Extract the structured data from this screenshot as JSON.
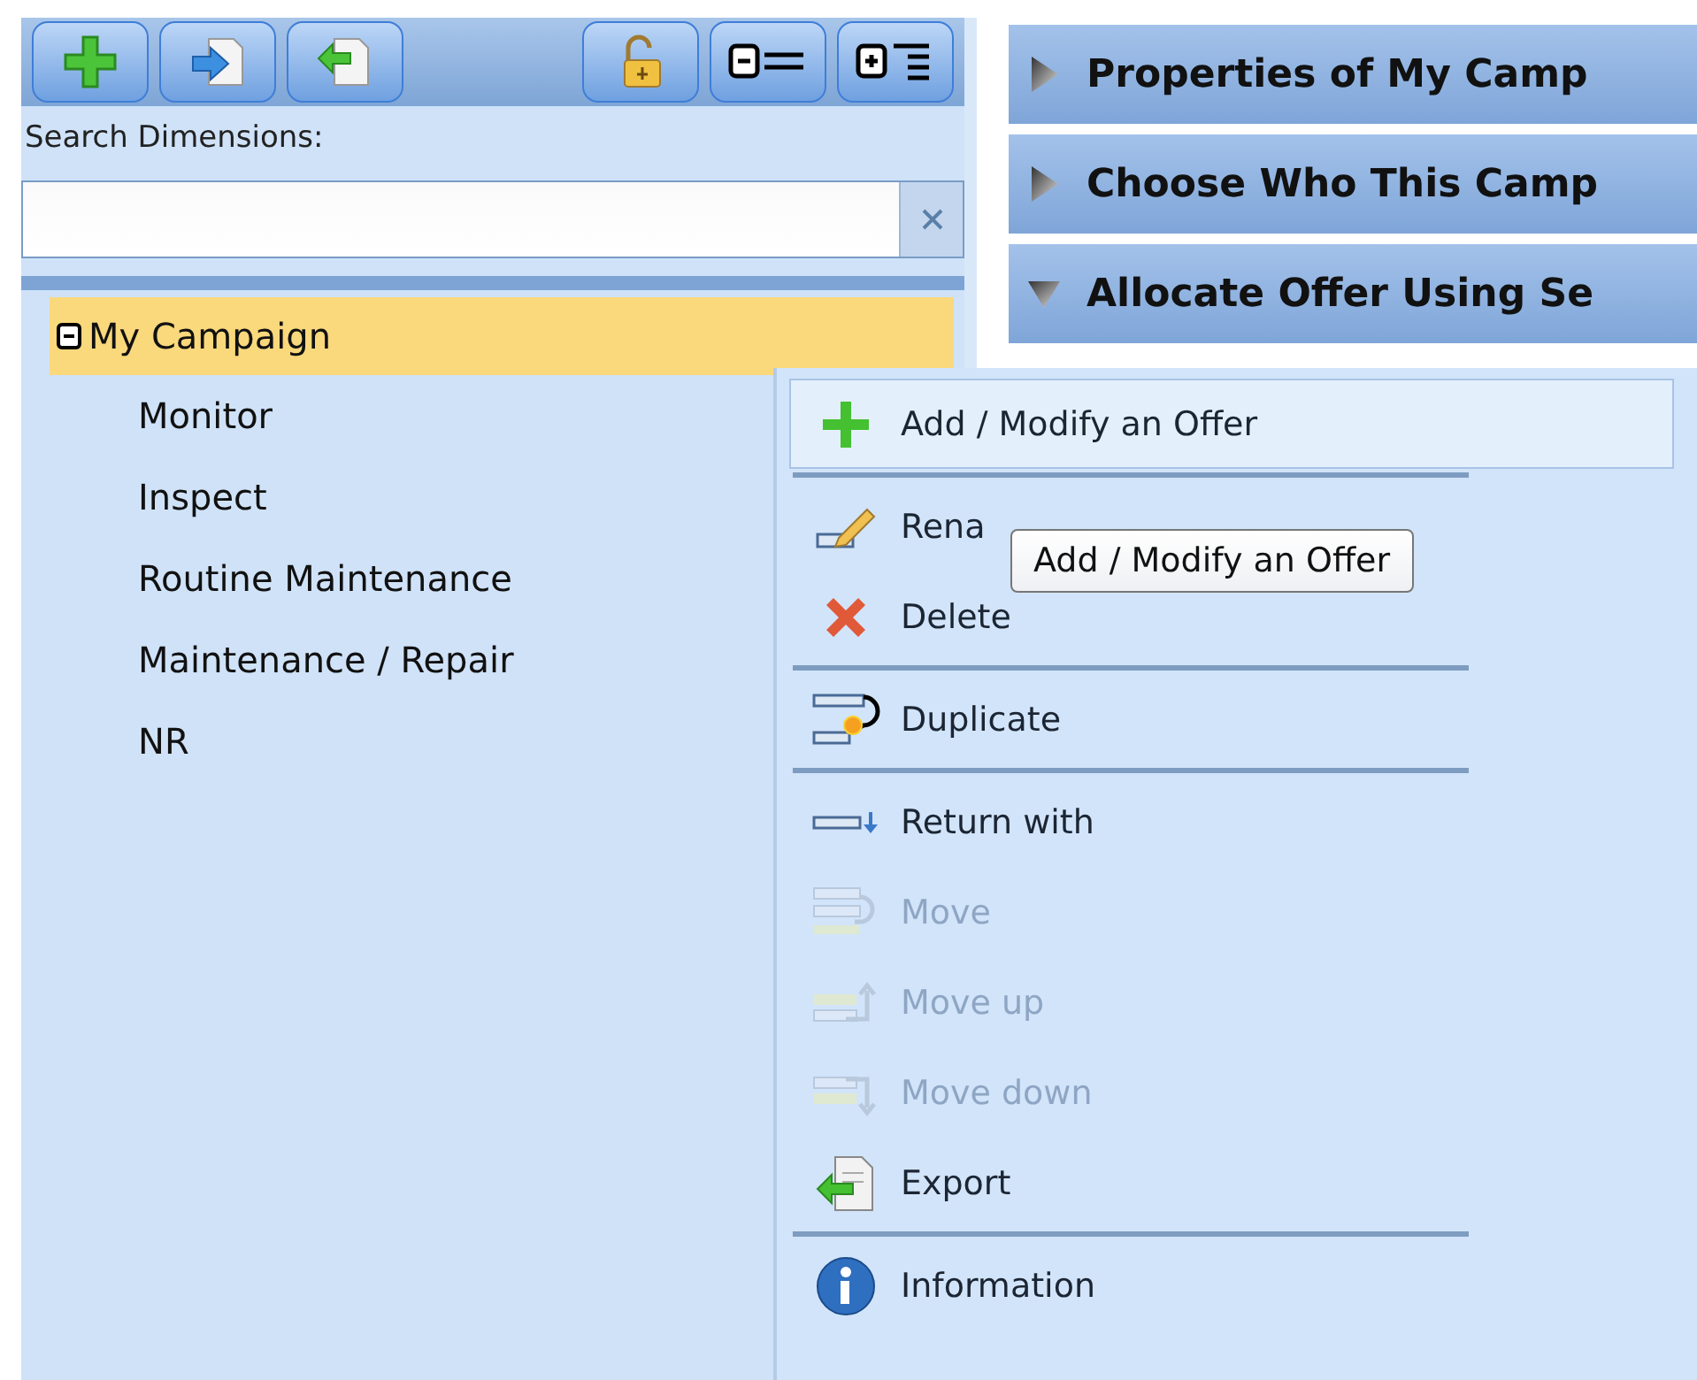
{
  "search": {
    "label": "Search Dimensions:"
  },
  "tree": {
    "label": "My Campaign",
    "expanded": true,
    "selected": true,
    "children": [
      {
        "label": "Monitor",
        "selected": false
      },
      {
        "label": "Inspect",
        "selected": false
      },
      {
        "label": "Routine Maintenance",
        "selected": false
      },
      {
        "label": "Maintenance / Repair",
        "selected": false
      },
      {
        "label": "NR",
        "selected": false
      }
    ]
  },
  "sections": [
    {
      "title": "Properties of My Camp",
      "expanded": false
    },
    {
      "title": "Choose Who This Camp",
      "expanded": false
    },
    {
      "title": "Allocate Offer Using Se",
      "expanded": true
    }
  ],
  "context_menu": {
    "items": [
      {
        "kind": "item",
        "label": "Add / Modify an Offer",
        "highlighted": true,
        "disabled": false
      },
      {
        "kind": "separator"
      },
      {
        "kind": "item",
        "label": "Rena",
        "highlighted": false,
        "disabled": false
      },
      {
        "kind": "item",
        "label": "Delete",
        "highlighted": false,
        "disabled": false
      },
      {
        "kind": "separator"
      },
      {
        "kind": "item",
        "label": "Duplicate",
        "highlighted": false,
        "disabled": false
      },
      {
        "kind": "separator"
      },
      {
        "kind": "item",
        "label": "Return with",
        "highlighted": false,
        "disabled": false
      },
      {
        "kind": "item",
        "label": "Move",
        "highlighted": false,
        "disabled": true
      },
      {
        "kind": "item",
        "label": "Move up",
        "highlighted": false,
        "disabled": true
      },
      {
        "kind": "item",
        "label": "Move down",
        "highlighted": false,
        "disabled": true
      },
      {
        "kind": "item",
        "label": "Export",
        "highlighted": false,
        "disabled": false
      },
      {
        "kind": "separator"
      },
      {
        "kind": "item",
        "label": "Information",
        "highlighted": false,
        "disabled": false
      }
    ]
  },
  "tooltip": {
    "text": "Add / Modify an Offer"
  }
}
